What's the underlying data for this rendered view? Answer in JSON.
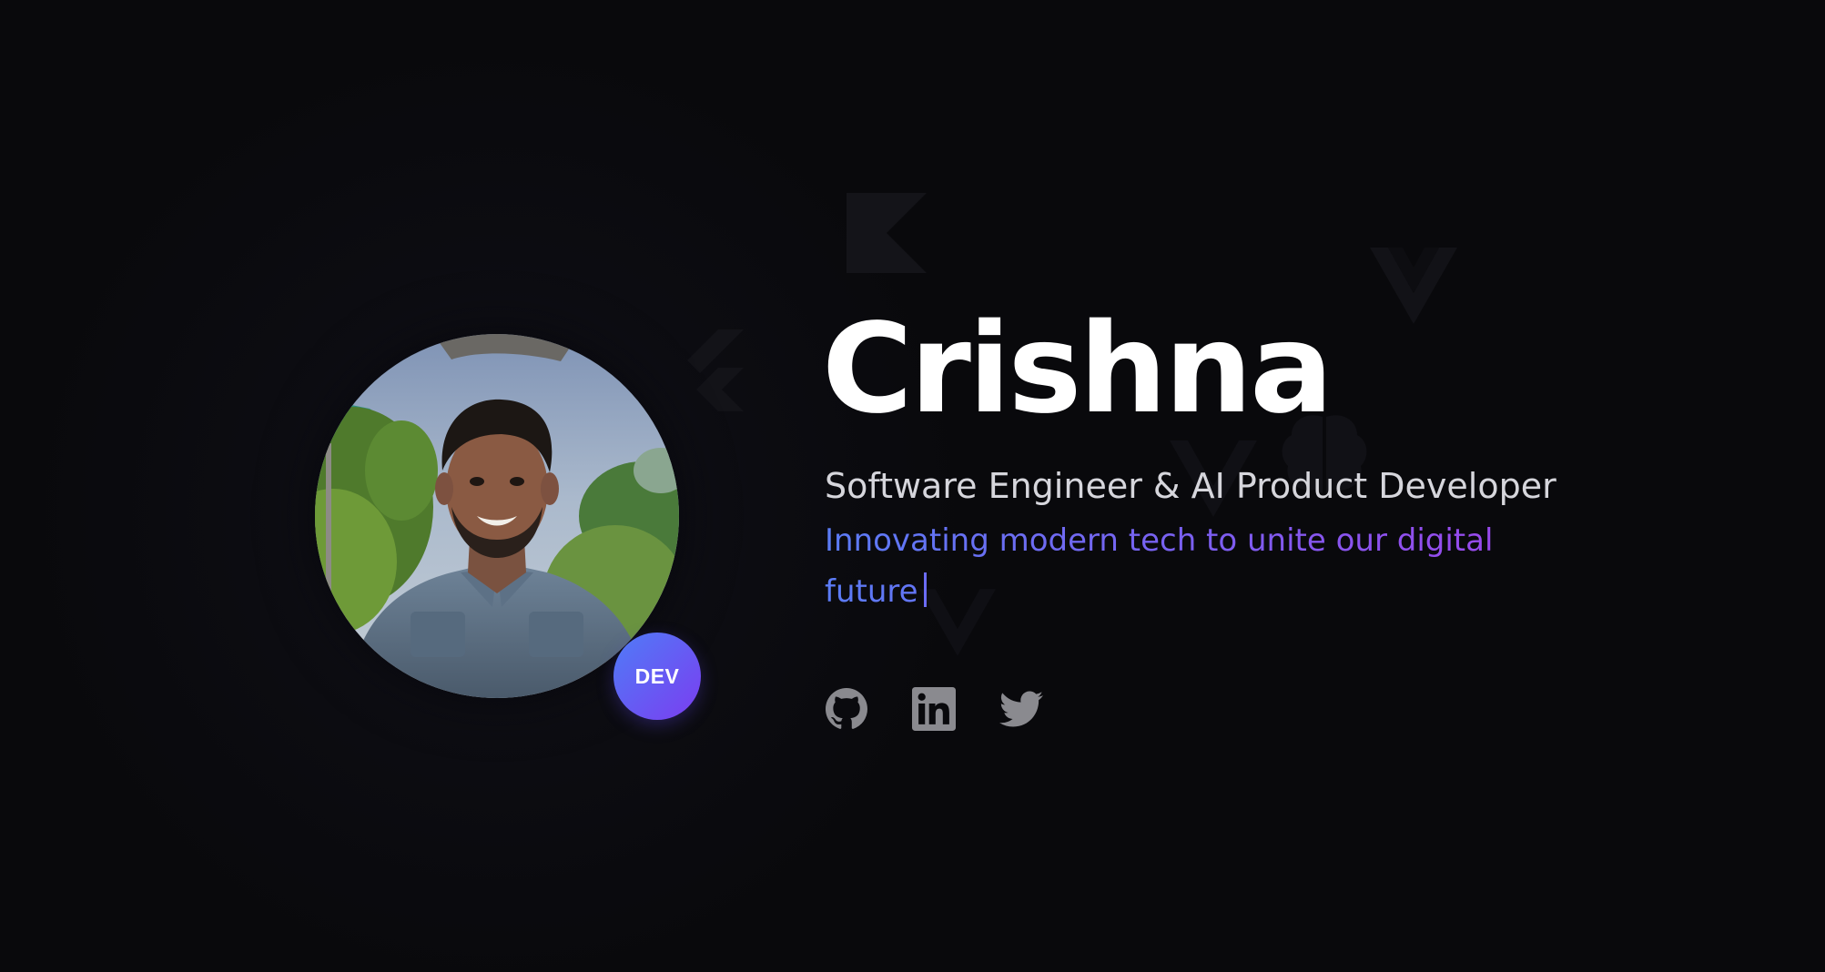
{
  "profile": {
    "name": "Crishna",
    "role": "Software Engineer & AI Product Developer",
    "tagline": "Innovating modern tech to unite our digital future",
    "badge": "DEV",
    "avatar_alt": "Profile photo"
  },
  "socials": [
    {
      "label": "GitHub",
      "icon": "github-icon"
    },
    {
      "label": "LinkedIn",
      "icon": "linkedin-icon"
    },
    {
      "label": "Twitter",
      "icon": "twitter-icon"
    }
  ],
  "colors": {
    "background": "#0a0a0d",
    "name": "#ffffff",
    "role": "#d6d6dc",
    "accent_start": "#5b7cf6",
    "accent_end": "#9b48ec",
    "social_icon": "#8a8a8f"
  },
  "background_icons": [
    "kotlin-icon",
    "flutter-icon",
    "vue-icon",
    "brain-icon"
  ]
}
